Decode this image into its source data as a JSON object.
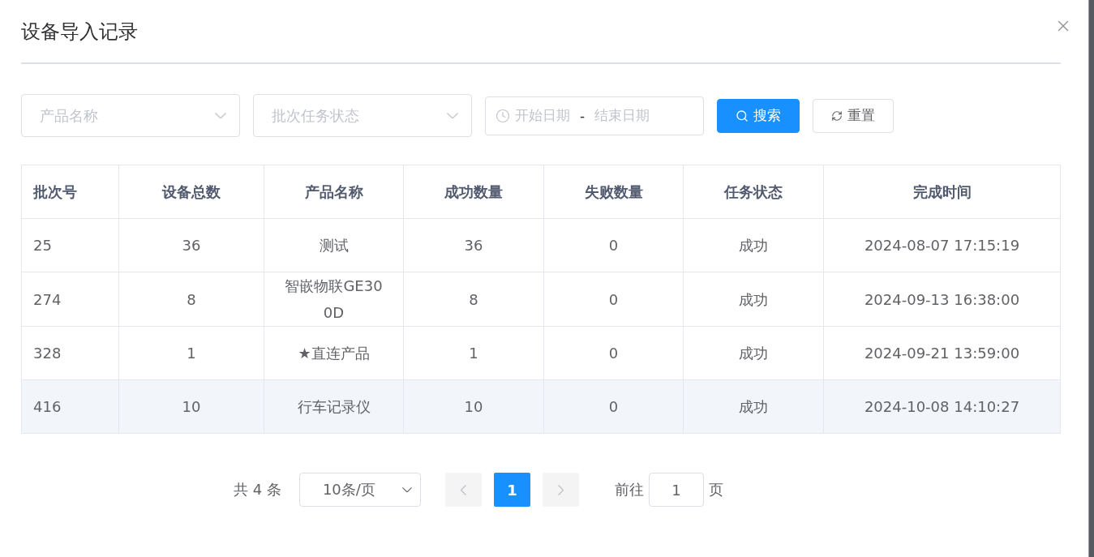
{
  "dialog": {
    "title": "设备导入记录"
  },
  "filters": {
    "product": {
      "placeholder": "产品名称"
    },
    "status": {
      "placeholder": "批次任务状态"
    },
    "date_range": {
      "start_placeholder": "开始日期",
      "separator": "-",
      "end_placeholder": "结束日期"
    },
    "search_button": "搜索",
    "reset_button": "重置"
  },
  "table": {
    "columns": [
      "批次号",
      "设备总数",
      "产品名称",
      "成功数量",
      "失败数量",
      "任务状态",
      "完成时间"
    ],
    "rows": [
      {
        "cells": [
          "25",
          "36",
          "测试",
          "36",
          "0",
          "成功",
          "2024-08-07 17:15:19"
        ],
        "highlighted": false
      },
      {
        "cells": [
          "274",
          "8",
          "智嵌物联GE300D",
          "8",
          "0",
          "成功",
          "2024-09-13 16:38:00"
        ],
        "highlighted": false
      },
      {
        "cells": [
          "328",
          "1",
          "★直连产品",
          "1",
          "0",
          "成功",
          "2024-09-21 13:59:00"
        ],
        "highlighted": false
      },
      {
        "cells": [
          "416",
          "10",
          "行车记录仪",
          "10",
          "0",
          "成功",
          "2024-10-08 14:10:27"
        ],
        "highlighted": true
      }
    ]
  },
  "pagination": {
    "total": "共 4 条",
    "page_size": "10条/页",
    "pages": [
      {
        "label": "1",
        "selected": true
      }
    ],
    "goto_label": "前往",
    "goto_value": "1",
    "goto_suffix": "页"
  }
}
